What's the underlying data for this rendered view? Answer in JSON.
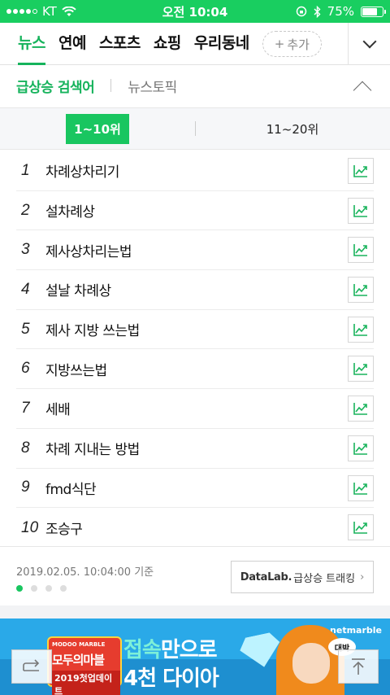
{
  "status": {
    "carrier": "KT",
    "time": "오전 10:04",
    "battery": "75%",
    "battery_level": 0.75
  },
  "nav": {
    "tabs": [
      "뉴스",
      "연예",
      "스포츠",
      "쇼핑",
      "우리동네"
    ],
    "active_tab": 0,
    "add_label": "추가",
    "accent": "#16b35c"
  },
  "section": {
    "title": "급상승 검색어",
    "topic": "뉴스토픽"
  },
  "range": {
    "tabs": [
      "1~10위",
      "11~20위"
    ],
    "active": 0
  },
  "keywords": [
    {
      "rank": "1",
      "text": "차례상차리기"
    },
    {
      "rank": "2",
      "text": "설차례상"
    },
    {
      "rank": "3",
      "text": "제사상차리는법"
    },
    {
      "rank": "4",
      "text": "설날 차례상"
    },
    {
      "rank": "5",
      "text": "제사 지방 쓰는법"
    },
    {
      "rank": "6",
      "text": "지방쓰는법"
    },
    {
      "rank": "7",
      "text": "세배"
    },
    {
      "rank": "8",
      "text": "차례 지내는 방법"
    },
    {
      "rank": "9",
      "text": "fmd식단"
    },
    {
      "rank": "10",
      "text": "조승구"
    }
  ],
  "footer": {
    "timestamp": "2019.02.05. 10:04:00 기준",
    "datalab_brand": "DataLab.",
    "datalab_label": "급상승 트래킹",
    "page_dots": 4,
    "active_dot": 0
  },
  "ad": {
    "brand": "netmarble",
    "logo_small": "MODOO MARBLE",
    "logo_main": "모두의마블",
    "logo_sub": "2019첫업데이트",
    "copy_hl": "접속",
    "copy_rest": "만으로",
    "copy_line2": "4천 다이아",
    "bubble": "대박"
  }
}
